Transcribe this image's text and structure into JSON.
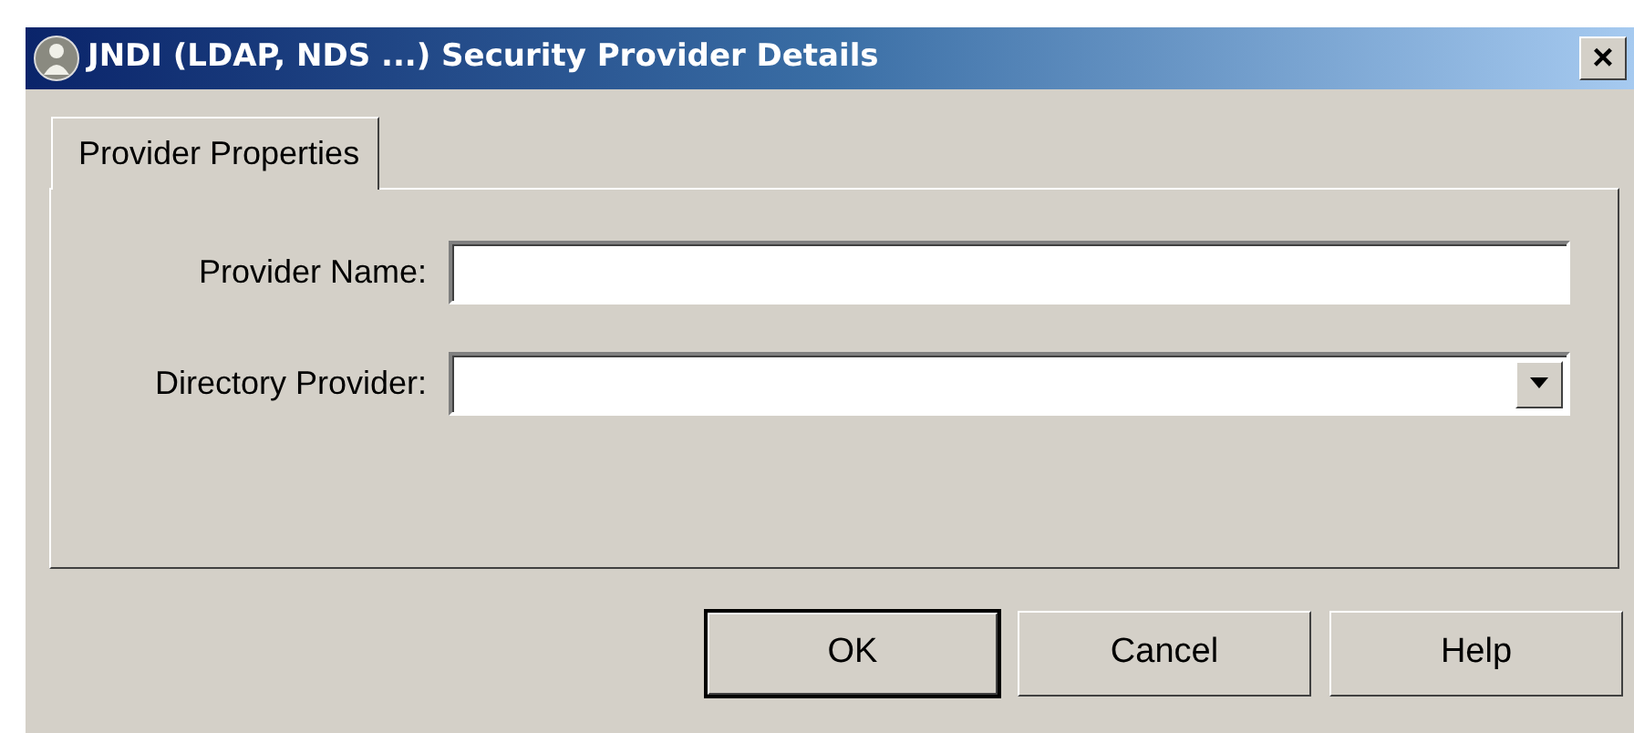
{
  "window": {
    "title": "JNDI (LDAP, NDS ...) Security Provider Details",
    "close": "×"
  },
  "tabs": [
    {
      "label": "Provider Properties",
      "selected": true
    }
  ],
  "fields": [
    {
      "kind": "text",
      "label": "Provider Name:"
    },
    {
      "kind": "dropdown",
      "label": "Directory Provider:"
    }
  ],
  "buttons": [
    {
      "label": "OK",
      "default": true
    },
    {
      "label": "Cancel",
      "default": false
    },
    {
      "label": "Help",
      "default": false
    }
  ]
}
